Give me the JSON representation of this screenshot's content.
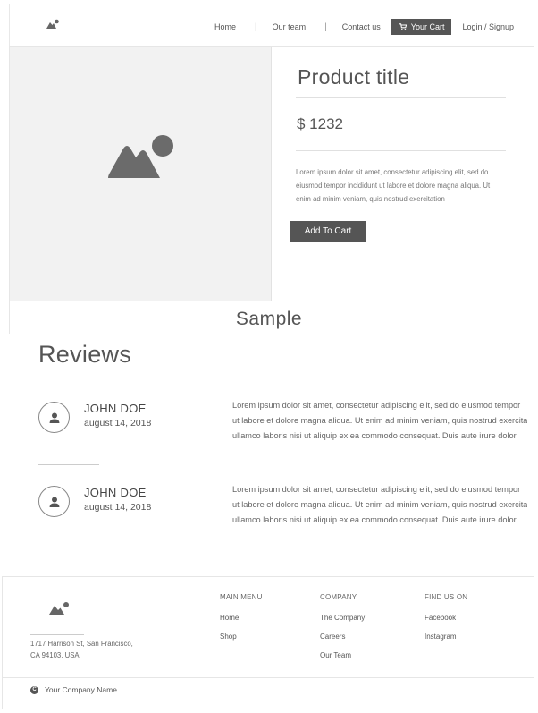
{
  "header": {
    "nav": [
      "Home",
      "Our team",
      "Contact us"
    ],
    "cart_label": "Your Cart",
    "login_label": "Login / Signup"
  },
  "product": {
    "title": "Product title",
    "price": "$ 1232",
    "description": "Lorem ipsum dolor sit amet, consectetur adipiscing elit, sed do eiusmod tempor incididunt ut labore et dolore magna aliqua. Ut enim ad minim veniam, quis nostrud exercitation",
    "add_to_cart_label": "Add To Cart"
  },
  "sample_label": "Sample",
  "reviews": {
    "title": "Reviews",
    "items": [
      {
        "name": "JOHN DOE",
        "date": "august 14, 2018",
        "text_lines": [
          "Lorem ipsum dolor sit amet, consectetur adipiscing elit, sed do eiusmod tempor",
          "ut labore et dolore magna aliqua. Ut enim ad minim veniam, quis nostrud exercitation",
          "ullamco laboris nisi ut aliquip ex ea commodo consequat. Duis aute irure dolor"
        ]
      },
      {
        "name": "JOHN DOE",
        "date": "august 14, 2018",
        "text_lines": [
          "Lorem ipsum dolor sit amet, consectetur adipiscing elit, sed do eiusmod tempor",
          "ut labore et dolore magna aliqua. Ut enim ad minim veniam, quis nostrud exercitation",
          "ullamco laboris nisi ut aliquip ex ea commodo consequat. Duis aute irure dolor"
        ]
      }
    ]
  },
  "footer": {
    "address_line1": "1717 Harrison St, San Francisco,",
    "address_line2": "CA 94103, USA",
    "columns": [
      {
        "heading": "MAIN MENU",
        "links": [
          "Home",
          "Shop"
        ]
      },
      {
        "heading": "COMPANY",
        "links": [
          "The Company",
          "Careers",
          "Our Team"
        ]
      },
      {
        "heading": "FIND US ON",
        "links": [
          "Facebook",
          "Instagram"
        ]
      }
    ],
    "copyright_symbol": "C",
    "copyright": "Your Company Name"
  },
  "colors": {
    "accent": "#555555",
    "image_placeholder": "#f2f2f2",
    "icon": "#6b6b6b"
  },
  "icons": [
    "logo-icon",
    "cart-icon",
    "image-placeholder-icon",
    "user-icon",
    "copyright-icon"
  ]
}
